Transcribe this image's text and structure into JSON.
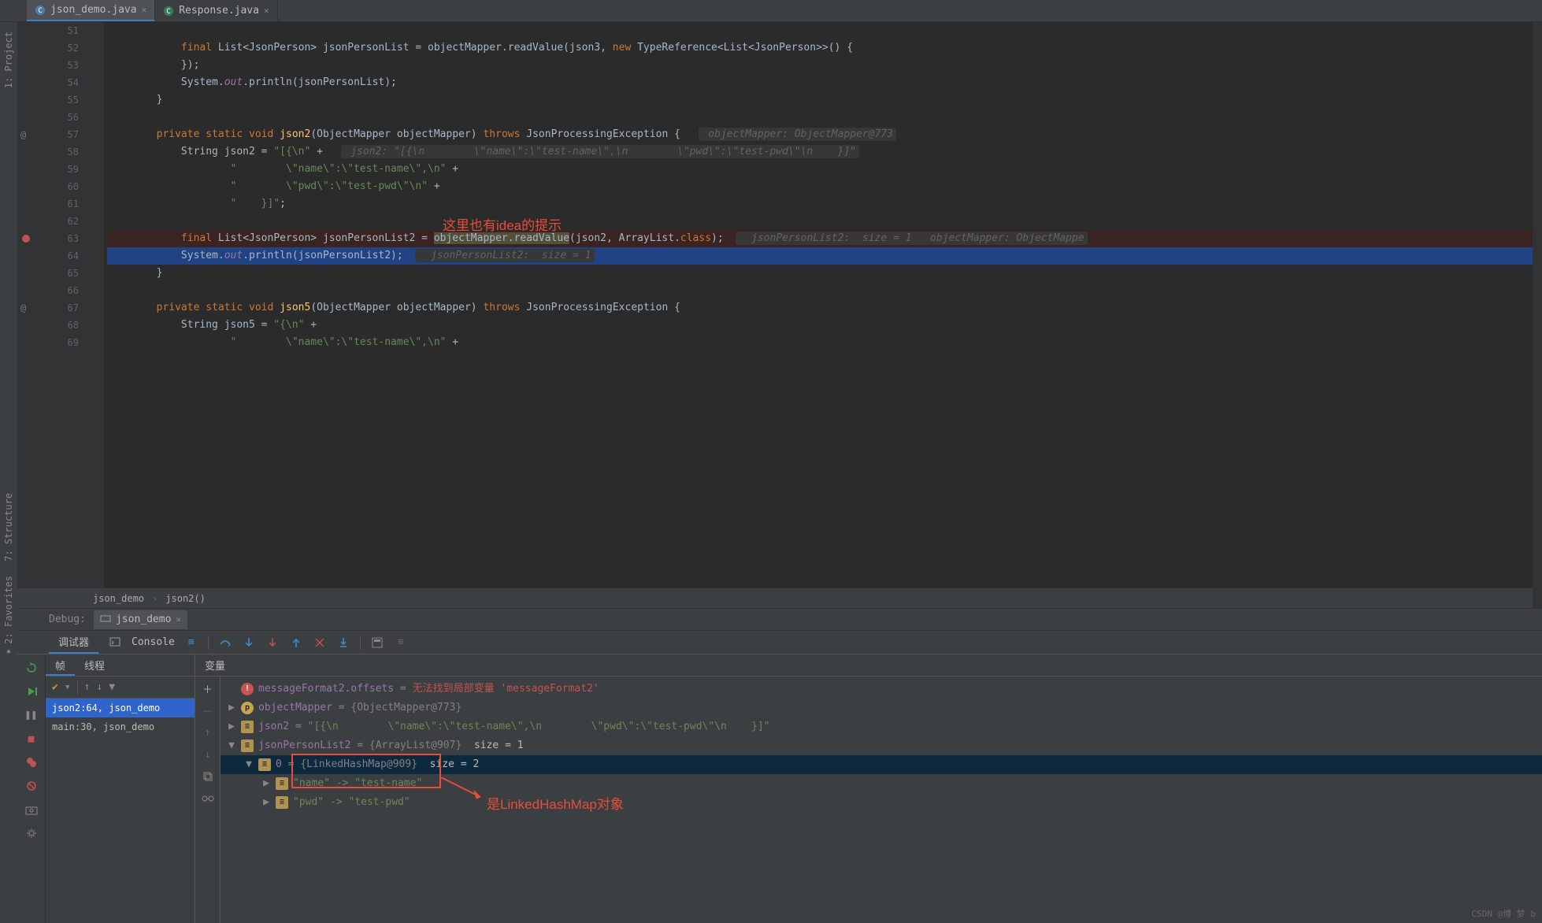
{
  "tabs": [
    {
      "label": "json_demo.java",
      "active": true
    },
    {
      "label": "Response.java",
      "active": false
    }
  ],
  "left_tools": [
    {
      "label": "1: Project"
    },
    {
      "label": "7: Structure"
    },
    {
      "label": "2: Favorites"
    }
  ],
  "code": {
    "line51": "",
    "line52": "            final List<JsonPerson> jsonPersonList = objectMapper.readValue(json3, new TypeReference<List<JsonPerson>>() {",
    "line53": "            });",
    "line54": "            System.out.println(jsonPersonList);",
    "line55": "        }",
    "line56": "",
    "line57": "        private static void json2(ObjectMapper objectMapper) throws JsonProcessingException {",
    "line58": "            String json2 = \"[{\\n\" +",
    "line59": "                    \"        \\\"name\\\":\\\"test-name\\\",\\n\" +",
    "line60": "                    \"        \\\"pwd\\\":\\\"test-pwd\\\"\\n\" +",
    "line61": "                    \"    }]\";",
    "line62": "",
    "line63": "            final List<JsonPerson> jsonPersonList2 = objectMapper.readValue(json2, ArrayList.class);",
    "line64": "            System.out.println(jsonPersonList2);",
    "line65": "        }",
    "line66": "",
    "line67": "        private static void json5(ObjectMapper objectMapper) throws JsonProcessingException {",
    "line68": "            String json5 = \"{\\n\" +",
    "line69": "                    \"        \\\"name\\\":\\\"test-name\\\",\\n\" +",
    "hint57": " objectMapper: ObjectMapper@773",
    "hint58": " json2: \"[{\\n        \\\"name\\\":\\\"test-name\\\",\\n        \\\"pwd\\\":\\\"test-pwd\\\"\\n    }]\"",
    "hint63": "  jsonPersonList2:  size = 1   objectMapper: ObjectMappe",
    "hint64": "  jsonPersonList2:  size = 1"
  },
  "line_numbers": [
    "51",
    "52",
    "53",
    "54",
    "55",
    "56",
    "57",
    "58",
    "59",
    "60",
    "61",
    "62",
    "63",
    "64",
    "65",
    "66",
    "67",
    "68",
    "69"
  ],
  "annotations": {
    "top": "这里也有idea的提示",
    "bottom": "是LinkedHashMap对象"
  },
  "breadcrumb": [
    "json_demo",
    "json2()"
  ],
  "debug": {
    "title": "Debug:",
    "run_config": "json_demo",
    "tabs": {
      "debugger": "调试器",
      "console": "Console"
    },
    "frames_tabs": {
      "frames": "帧",
      "threads": "线程"
    },
    "vars_title": "变量",
    "frames": [
      {
        "label": "json2:64, json_demo",
        "selected": true
      },
      {
        "label": "main:30, json_demo",
        "selected": false
      }
    ],
    "vars": [
      {
        "indent": 0,
        "arrow": "",
        "icon": "err",
        "name": "messageFormat2.offsets",
        "eq": " = ",
        "obj": "",
        "val": "无法找到局部变量 'messageFormat2'",
        "selected": false
      },
      {
        "indent": 0,
        "arrow": "▶",
        "icon": "p",
        "name": "objectMapper",
        "eq": " = ",
        "obj": "{ObjectMapper@773}",
        "val": "",
        "selected": false
      },
      {
        "indent": 0,
        "arrow": "▶",
        "icon": "f",
        "name": "json2",
        "eq": " = ",
        "obj": "",
        "val": "\"[{\\n        \\\"name\\\":\\\"test-name\\\",\\n        \\\"pwd\\\":\\\"test-pwd\\\"\\n    }]\"",
        "selected": false
      },
      {
        "indent": 0,
        "arrow": "▼",
        "icon": "f",
        "name": "jsonPersonList2",
        "eq": " = ",
        "obj": "{ArrayList@907} ",
        "val": " size = 1",
        "selected": false
      },
      {
        "indent": 1,
        "arrow": "▼",
        "icon": "f",
        "name": "0",
        "eq": " = ",
        "obj": "{LinkedHashMap@909} ",
        "val": " size = 2",
        "selected": true
      },
      {
        "indent": 2,
        "arrow": "▶",
        "icon": "f",
        "name": "",
        "eq": "",
        "obj": "",
        "val": "\"name\" -> \"test-name\"",
        "selected": false
      },
      {
        "indent": 2,
        "arrow": "▶",
        "icon": "f",
        "name": "",
        "eq": "",
        "obj": "",
        "val": "\"pwd\" -> \"test-pwd\"",
        "selected": false
      }
    ]
  },
  "watermark": "CSDN @博 梦 b"
}
